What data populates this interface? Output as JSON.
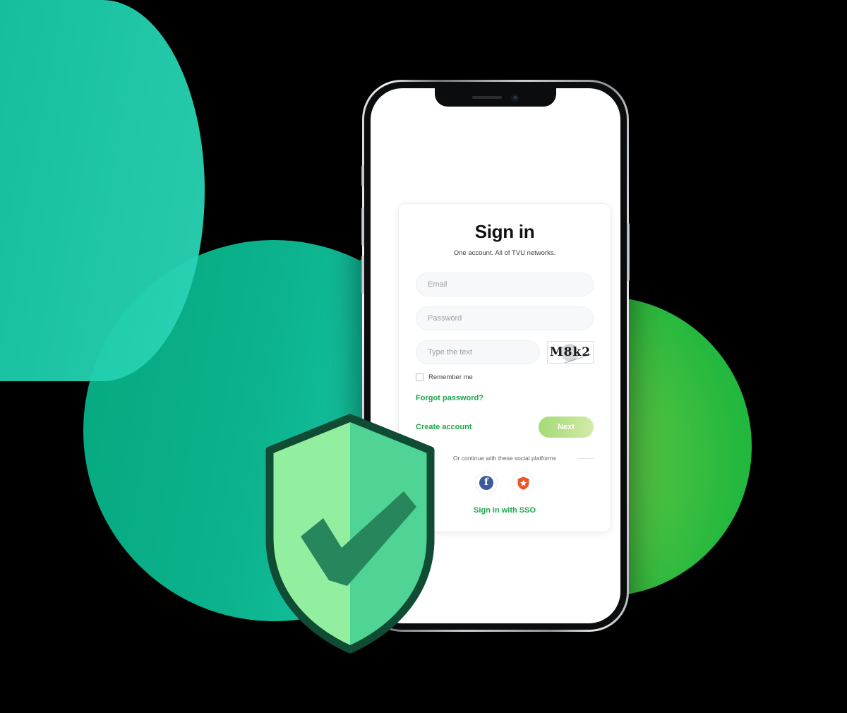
{
  "signin": {
    "title": "Sign in",
    "subtitle": "One account. All of TVU networks.",
    "fields": {
      "email_placeholder": "Email",
      "password_placeholder": "Password",
      "captcha_placeholder": "Type the text"
    },
    "captcha_text": "M8k2",
    "remember_label": "Remember me",
    "forgot_password_label": "Forgot password?",
    "create_account_label": "Create account",
    "next_label": "Next",
    "social_divider_label": "Or continue with these social platforms",
    "social_buttons": [
      {
        "name": "facebook",
        "glyph": "f"
      },
      {
        "name": "auth0",
        "glyph": "auth0-shield"
      }
    ],
    "sso_label": "Sign in with SSO"
  },
  "colors": {
    "link_green": "#1aa84a",
    "next_button_gradient_start": "#a4db79",
    "next_button_gradient_end": "#d3ecab",
    "facebook_blue": "#3b5ba0",
    "auth0_red": "#eb5424",
    "blob_teal": "#0bb28c",
    "blob_green_top": "#22b545",
    "blob_green_right": "#27b93e",
    "shield_light": "#93efa0",
    "shield_mid": "#4fd495",
    "shield_outline": "#0f4c33",
    "shield_check": "#27865c",
    "page_background": "#000000"
  },
  "device": {
    "type": "smartphone",
    "notch": {
      "speaker": "speaker-grille",
      "camera": "front-camera"
    },
    "side_buttons": [
      "silent-switch",
      "volume-up",
      "volume-down",
      "power"
    ]
  }
}
